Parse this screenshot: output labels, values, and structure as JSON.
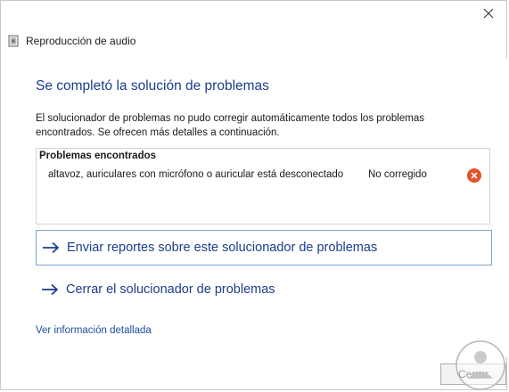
{
  "window": {
    "title": "Reproducción de audio",
    "app_icon": "audio-troubleshooter-icon",
    "close_icon": "close-icon"
  },
  "main": {
    "heading": "Se completó la solución de problemas",
    "description": "El solucionador de problemas no pudo corregir automáticamente todos los problemas encontrados. Se ofrecen más detalles a continuación.",
    "problems": {
      "header": "Problemas encontrados",
      "rows": [
        {
          "text": "altavoz, auriculares con micrófono o auricular está desconectado",
          "status": "No corregido",
          "status_icon": "error-x-icon",
          "status_color": "#e0532b"
        }
      ]
    },
    "links": [
      {
        "label": "Enviar reportes sobre este solucionador de problemas",
        "icon": "arrow-right-icon"
      },
      {
        "label": "Cerrar el solucionador de problemas",
        "icon": "arrow-right-icon"
      }
    ],
    "detail_link": "Ver información detallada"
  },
  "footer": {
    "close_button": "Cerrar"
  },
  "colors": {
    "heading": "#1c3e8c",
    "link": "#1c3e8c",
    "accent_border": "#7aa7d4",
    "error": "#e0532b"
  }
}
